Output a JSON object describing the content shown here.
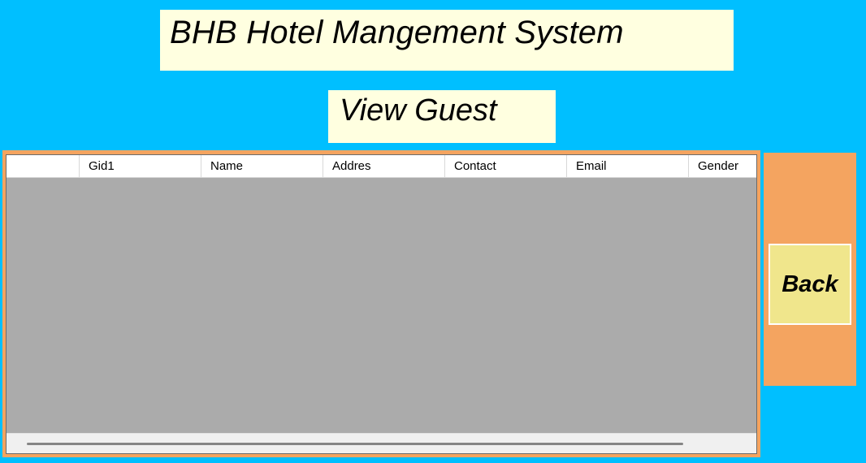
{
  "header": {
    "title": "BHB Hotel Mangement System",
    "subtitle": "View Guest"
  },
  "grid": {
    "columns": [
      "Gid1",
      "Name",
      "Addres",
      "Contact",
      "Email",
      "Gender"
    ],
    "rows": []
  },
  "actions": {
    "back_label": "Back"
  },
  "colors": {
    "background": "#00BFFF",
    "label_background": "#FFFFE0",
    "panel": "#F4A460",
    "grid_background": "#ABABAB",
    "button": "#F0E68C"
  }
}
